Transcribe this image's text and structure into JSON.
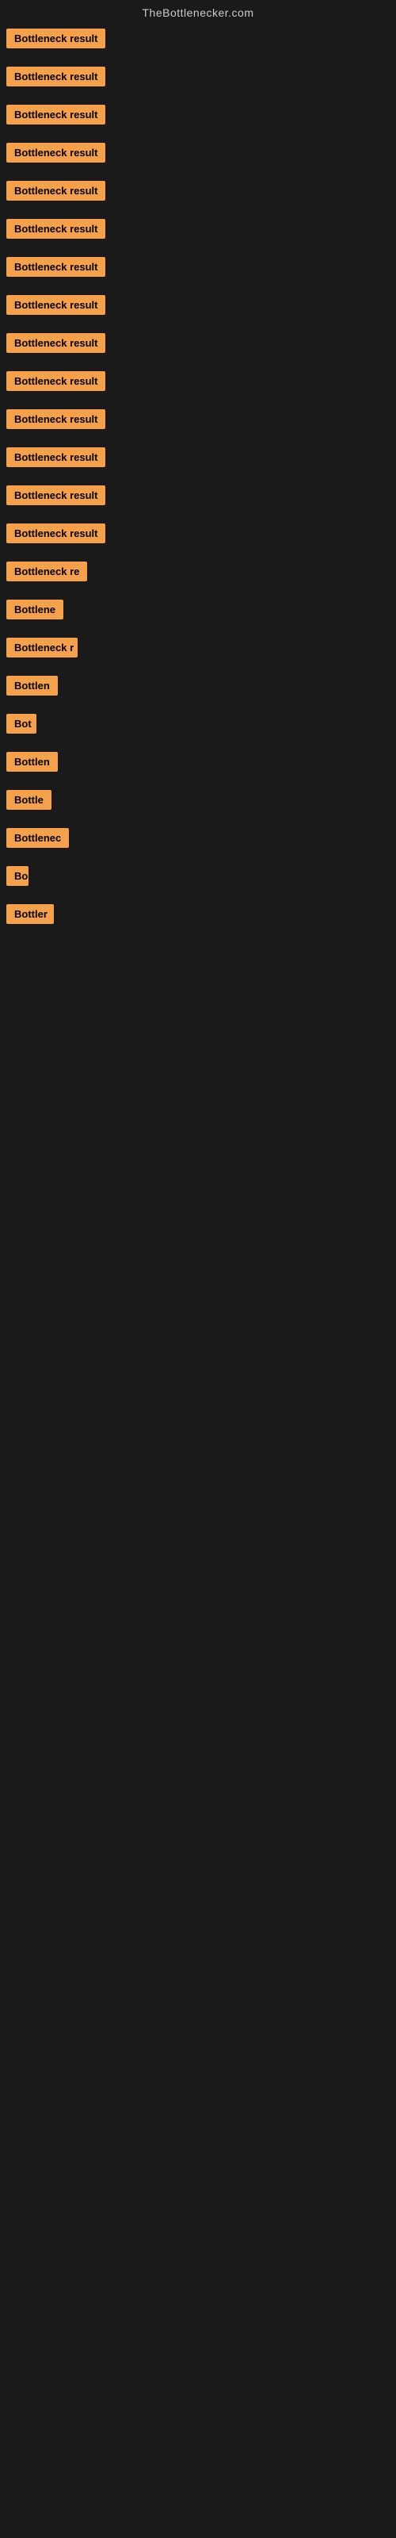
{
  "site": {
    "title": "TheBottlenecker.com"
  },
  "items": [
    {
      "id": 1,
      "label": "Bottleneck result",
      "width": 130
    },
    {
      "id": 2,
      "label": "Bottleneck result",
      "width": 130
    },
    {
      "id": 3,
      "label": "Bottleneck result",
      "width": 130
    },
    {
      "id": 4,
      "label": "Bottleneck result",
      "width": 130
    },
    {
      "id": 5,
      "label": "Bottleneck result",
      "width": 130
    },
    {
      "id": 6,
      "label": "Bottleneck result",
      "width": 130
    },
    {
      "id": 7,
      "label": "Bottleneck result",
      "width": 130
    },
    {
      "id": 8,
      "label": "Bottleneck result",
      "width": 130
    },
    {
      "id": 9,
      "label": "Bottleneck result",
      "width": 130
    },
    {
      "id": 10,
      "label": "Bottleneck result",
      "width": 130
    },
    {
      "id": 11,
      "label": "Bottleneck result",
      "width": 130
    },
    {
      "id": 12,
      "label": "Bottleneck result",
      "width": 130
    },
    {
      "id": 13,
      "label": "Bottleneck result",
      "width": 130
    },
    {
      "id": 14,
      "label": "Bottleneck result",
      "width": 130
    },
    {
      "id": 15,
      "label": "Bottleneck re",
      "width": 105
    },
    {
      "id": 16,
      "label": "Bottlene",
      "width": 80
    },
    {
      "id": 17,
      "label": "Bottleneck r",
      "width": 90
    },
    {
      "id": 18,
      "label": "Bottlen",
      "width": 72
    },
    {
      "id": 19,
      "label": "Bot",
      "width": 38
    },
    {
      "id": 20,
      "label": "Bottlen",
      "width": 72
    },
    {
      "id": 21,
      "label": "Bottle",
      "width": 62
    },
    {
      "id": 22,
      "label": "Bottlenec",
      "width": 82
    },
    {
      "id": 23,
      "label": "Bo",
      "width": 28
    },
    {
      "id": 24,
      "label": "Bottler",
      "width": 60
    }
  ]
}
